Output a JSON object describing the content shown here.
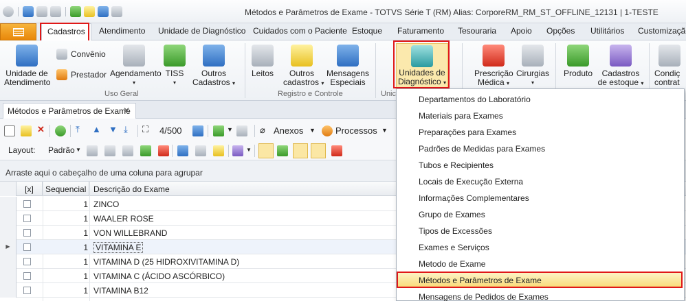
{
  "window": {
    "title": "Métodos e Parâmetros de Exame - TOTVS Série T  (RM) Alias: CorporeRM_RM_ST_OFFLINE_12131 | 1-TESTE"
  },
  "ribbon_tabs": [
    "Cadastros",
    "Atendimento",
    "Unidade de Diagnóstico",
    "Cuidados com o Paciente",
    "Estoque",
    "Faturamento",
    "Tesouraria",
    "Apoio",
    "Opções",
    "Utilitários",
    "Customização"
  ],
  "ribbon": {
    "unidade_atendimento": [
      "Unidade de",
      "Atendimento"
    ],
    "convenio": "Convênio",
    "prestador": "Prestador",
    "agendamento": "Agendamento",
    "tiss": "TISS",
    "outros_cadastros": [
      "Outros",
      "Cadastros"
    ],
    "leitos": "Leitos",
    "outros_cadastros2": [
      "Outros",
      "cadastros"
    ],
    "mensagens_especiais": [
      "Mensagens",
      "Especiais"
    ],
    "unidades_diagnostico": [
      "Unidades de",
      "Diagnóstico"
    ],
    "prescricao_medica": [
      "Prescrição",
      "Médica"
    ],
    "cirurgias": "Cirurgias",
    "produto": "Produto",
    "cadastros_estoque": [
      "Cadastros",
      "de estoque"
    ],
    "condicoes": [
      "Condiç",
      "contrat"
    ],
    "group_uso_geral": "Uso Geral",
    "group_registro": "Registro e Controle",
    "group_unid": "Unic"
  },
  "document_tab": "Métodos e Parâmetros de Exame",
  "toolbar": {
    "record_count": "4/500",
    "anexos": "Anexos",
    "processos": "Processos",
    "layout_label": "Layout:",
    "layout_value": "Padrão"
  },
  "group_panel_text": "Arraste aqui o cabeçalho de uma coluna para agrupar",
  "grid": {
    "headers": [
      "[x]",
      "Sequencial",
      "Descrição do Exame"
    ],
    "rows": [
      {
        "seq": "1",
        "desc": "ZINCO"
      },
      {
        "seq": "1",
        "desc": "WAALER ROSE"
      },
      {
        "seq": "1",
        "desc": "VON WILLEBRAND"
      },
      {
        "seq": "1",
        "desc": "VITAMINA E"
      },
      {
        "seq": "1",
        "desc": "VITAMINA D (25 HIDROXIVITAMINA D)"
      },
      {
        "seq": "1",
        "desc": "VITAMINA C (ÁCIDO ASCÓRBICO)"
      },
      {
        "seq": "1",
        "desc": "VITAMINA B12"
      }
    ]
  },
  "dropdown_menu": [
    "Departamentos do Laboratório",
    "Materiais para Exames",
    "Preparações para Exames",
    "Padrões de Medidas para Exames",
    "Tubos e Recipientes",
    "Locais de Execução Externa",
    "Informações Complementares",
    "Grupo de Exames",
    "Tipos de Excessões",
    "Exames e Serviços",
    "Metodo de Exame",
    "Métodos e Parâmetros de Exame",
    "Mensagens de Pedidos de Exames"
  ],
  "colors": {
    "highlight_red": "#e01818",
    "menu_highlight": "#f9dc7c",
    "file_button": "#e8870a"
  }
}
